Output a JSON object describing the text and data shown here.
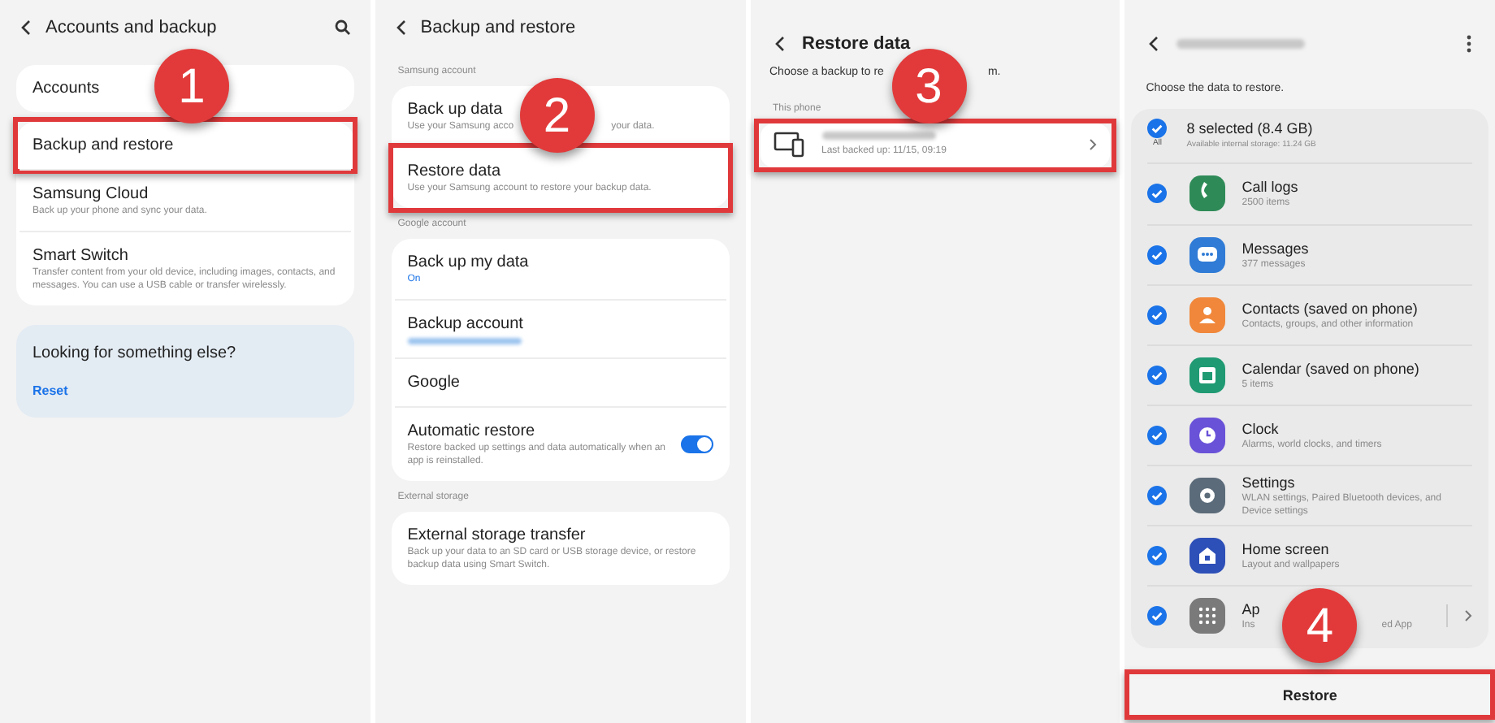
{
  "panels": [
    {
      "kind": "settings",
      "title": "Accounts and backup",
      "search": true,
      "step": "1",
      "groups": [
        {
          "items": [
            {
              "title": "Accounts",
              "highlighted": false
            }
          ]
        },
        {
          "items": [
            {
              "title": "Backup and restore",
              "highlighted": true
            },
            {
              "title": "Samsung Cloud",
              "subtitle": "Back up your phone and sync your data.",
              "highlighted": false
            },
            {
              "title": "Smart Switch",
              "subtitle": "Transfer content from your old device, including images, contacts, and messages. You can use a USB cable or transfer wirelessly.",
              "highlighted": false
            }
          ]
        }
      ],
      "suggestion": {
        "title": "Looking for something else?",
        "link": "Reset"
      }
    },
    {
      "kind": "settings",
      "title": "Backup and restore",
      "step": "2",
      "groups": [
        {
          "label": "Samsung account",
          "items": [
            {
              "title": "Back up data",
              "subtitle": [
                "Use your Samsung acco",
                "your data."
              ],
              "highlighted": false
            },
            {
              "title": "Restore data",
              "subtitle": "Use your Samsung account to restore your backup data.",
              "highlighted": true
            }
          ]
        },
        {
          "label": "Google account",
          "items": [
            {
              "title": "Back up my data",
              "value": "On",
              "highlighted": false
            },
            {
              "title": "Backup account",
              "redacted": true,
              "highlighted": false
            },
            {
              "title": "Google",
              "highlighted": false
            },
            {
              "title": "Automatic restore",
              "subtitle": "Restore backed up settings and data automatically when an app is reinstalled.",
              "toggle": {
                "on": true
              },
              "highlighted": false
            }
          ]
        },
        {
          "label": "External storage",
          "items": [
            {
              "title": "External storage transfer",
              "subtitle": "Back up your data to an SD card or USB storage device, or restore backup data using Smart Switch.",
              "highlighted": false
            }
          ]
        }
      ]
    },
    {
      "kind": "backups",
      "title": "Restore data",
      "step": "3",
      "intro": [
        "Choose a backup to re",
        "m."
      ],
      "section": "This phone",
      "backups": [
        {
          "detail": "Last backed up: 11/15, 09:19",
          "highlighted": true
        }
      ]
    },
    {
      "kind": "restore",
      "step": "4",
      "intro": "Choose the data to restore.",
      "summary": {
        "title": "8 selected (8.4 GB)",
        "subtitle": "Available internal storage: 11.24 GB",
        "all_label": "All",
        "checked": true
      },
      "items": [
        {
          "kind": "phone",
          "color": "#2e8b57",
          "title": "Call logs",
          "subtitle": "2500 items",
          "checked": true
        },
        {
          "kind": "chat",
          "color": "#2f7bd6",
          "title": "Messages",
          "subtitle": "377 messages",
          "checked": true
        },
        {
          "kind": "person",
          "color": "#f0873a",
          "title": "Contacts (saved on phone)",
          "subtitle": "Contacts, groups, and other information",
          "checked": true
        },
        {
          "kind": "calendar",
          "color": "#1f9a72",
          "title": "Calendar (saved on phone)",
          "subtitle": "5 items",
          "checked": true
        },
        {
          "kind": "clock",
          "color": "#6a52d8",
          "title": "Clock",
          "subtitle": "Alarms, world clocks, and timers",
          "checked": true
        },
        {
          "kind": "gear",
          "color": "#5b6b79",
          "title": "Settings",
          "subtitle": "WLAN settings, Paired Bluetooth devices, and Device settings",
          "checked": true
        },
        {
          "kind": "home",
          "color": "#2d4fb8",
          "title": "Home screen",
          "subtitle": "Layout and wallpapers",
          "checked": true
        },
        {
          "kind": "grid",
          "color": "#7a7a7a",
          "title": "Ap",
          "subtitle": [
            "Ins",
            "ed App"
          ],
          "more": true,
          "checked": true
        }
      ],
      "button": {
        "label": "Restore",
        "highlighted": true
      }
    }
  ]
}
